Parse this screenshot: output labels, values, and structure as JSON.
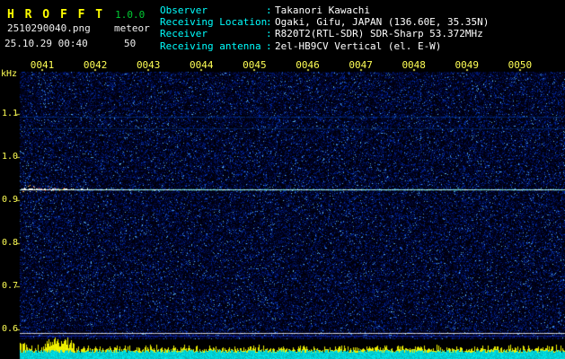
{
  "header": {
    "app_title": "H R O F F T",
    "version": "1.0.0",
    "filename": "2510290040.png",
    "mode": "meteor",
    "datetime": "25.10.29 00:40",
    "gain": "50",
    "separator": ":",
    "info": [
      {
        "label": "Observer",
        "value": "Takanori Kawachi"
      },
      {
        "label": "Receiving Location",
        "value": "Ogaki, Gifu, JAPAN (136.60E, 35.35N)"
      },
      {
        "label": "Receiver",
        "value": "R820T2(RTL-SDR) SDR-Sharp 53.372MHz"
      },
      {
        "label": "Receiving antenna",
        "value": "2el-HB9CV Vertical (el. E-W)"
      }
    ]
  },
  "chart_data": {
    "type": "heatmap",
    "title": "HROFFT 10-minute meteor radio spectrogram",
    "x_ticks": [
      "0041",
      "0042",
      "0043",
      "0044",
      "0045",
      "0046",
      "0047",
      "0048",
      "0049",
      "0050"
    ],
    "y_ticks": [
      "1.1",
      "1.0",
      "0.9",
      "0.8",
      "0.7",
      "0.6"
    ],
    "y_unit_label": "kHz",
    "ylim_khz": [
      0.58,
      1.2
    ],
    "x_range_hhmm": [
      "0040",
      "0050"
    ],
    "carrier_line_khz": 0.925,
    "faint_lines_khz": [
      1.093,
      1.066
    ],
    "reference_lines_khz": [
      0.592,
      0.586
    ],
    "echo_events": [
      {
        "time_hhmm": "0040",
        "khz": 0.93,
        "appearance": "bright echo trace with red/yellow speckle at left edge of carrier line"
      }
    ],
    "bottom_strip": "per-second signal level bars, yellow over cyan",
    "colors": {
      "noise_blue": "#2030c0",
      "carrier": "#b0ffff",
      "echo_red": "#ff5028",
      "bar_yellow": "#ffff00",
      "bar_cyan": "#00dddd",
      "axis_label": "#ffff55",
      "info_label": "#00ffff",
      "info_value": "#ffffff",
      "title": "#ffff00",
      "version": "#00cc33"
    }
  }
}
